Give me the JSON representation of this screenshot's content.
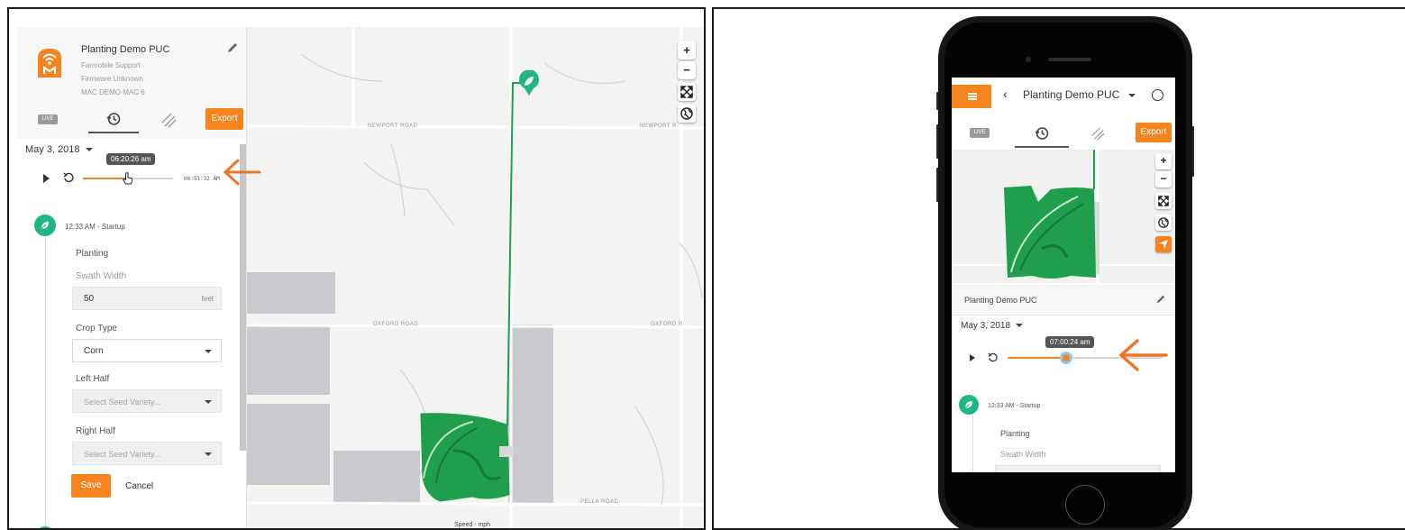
{
  "device": {
    "name": "Planting Demo PUC",
    "support": "Farmobile Support",
    "firmware": "Firmware Unknown",
    "mac": "MAC DEMO MAC 6"
  },
  "tabs": {
    "live": "LIVE",
    "export": "Export"
  },
  "date": "May 3, 2018",
  "desktop_playback": {
    "current_time": "06:20:26 am",
    "end_time": "06:51:32 AM",
    "progress": 0.5
  },
  "mobile_playback": {
    "current_time": "07:00:24 am",
    "progress": 0.38
  },
  "event": {
    "title": "12:33 AM - Startup",
    "operation": "Planting",
    "swath_label": "Swath Width",
    "swath_value": "50",
    "swath_unit": "feet",
    "crop_label": "Crop Type",
    "crop_value": "Corn",
    "left_label": "Left Half",
    "left_placeholder": "Select Seed Variety...",
    "right_label": "Right Half",
    "right_placeholder": "Select Seed Variety...",
    "save": "Save",
    "cancel": "Cancel"
  },
  "map": {
    "roads": {
      "newport": "NEWPORT ROAD",
      "newport_short": "NEWPORT R",
      "oxford": "OXFORD ROAD",
      "oxford_short": "OXFORD R",
      "pella": "PELLA ROAD"
    },
    "speed_label": "Speed - mph",
    "controls": {
      "zoom_in": "+",
      "zoom_out": "−"
    },
    "track_color": "#1f9e4c",
    "parcel_color": "#c8c9cc"
  },
  "mobile": {
    "title": "Planting Demo PUC",
    "back": "‹",
    "card_title": "Planting Demo PUC"
  },
  "colors": {
    "accent": "#f5841f",
    "event": "#1fb683",
    "arrow": "#e8772a"
  }
}
